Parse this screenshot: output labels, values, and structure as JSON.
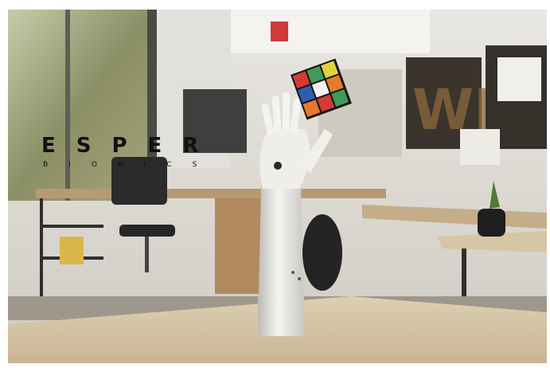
{
  "brand": {
    "wordmark": "ESPER",
    "subtitle": "BIONICS"
  },
  "colors": {
    "logo": "#111111",
    "hand": "#f1f0ec",
    "desk": "#d9c7a6",
    "cube_red": "#d63a33",
    "cube_green": "#3f9b57",
    "cube_yellow": "#e3d23a",
    "cube_blue": "#2d5fb1",
    "cube_orange": "#e57a2c",
    "cube_white": "#f2f2f2"
  },
  "scene": {
    "subject": "prosthetic-hand-icon",
    "object": "rubiks-cube-icon"
  }
}
